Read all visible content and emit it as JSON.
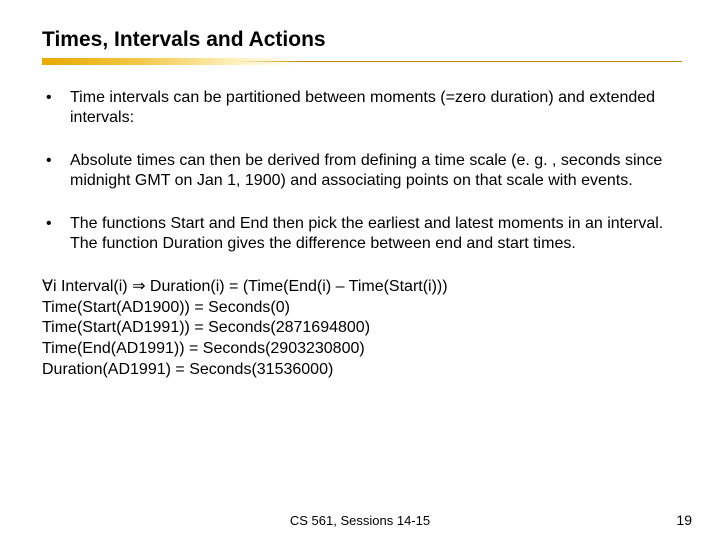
{
  "title": "Times, Intervals and Actions",
  "bullets": [
    "Time intervals can be partitioned between moments (=zero duration) and extended intervals:",
    "Absolute times can then be derived from defining a time scale (e. g. , seconds since midnight GMT on Jan 1, 1900) and associating points on that scale with events.",
    "The functions Start and End then pick the earliest and latest moments in an interval. The function Duration gives the difference between end and start times."
  ],
  "equations": [
    "∀i Interval(i) ⇒ Duration(i) = (Time(End(i) – Time(Start(i)))",
    "Time(Start(AD1900)) = Seconds(0)",
    "Time(Start(AD1991)) = Seconds(2871694800)",
    "Time(End(AD1991)) = Seconds(2903230800)",
    "Duration(AD1991) = Seconds(31536000)"
  ],
  "footer": "CS 561,  Sessions 14-15",
  "page_number": "19"
}
